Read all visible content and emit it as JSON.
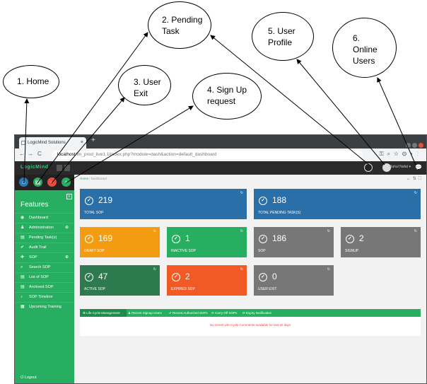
{
  "callouts": {
    "home": "1. Home",
    "pending_task": "2. Pending\nTask",
    "user_exit": "3. User\nExit",
    "signup_request": "4. Sign Up\nrequest",
    "user_profile": "5. User\nProfile",
    "online_users": "6.\nOnline\nUsers"
  },
  "browser": {
    "tab_title": "LogicMind Solutions",
    "tab_close": "×",
    "new_tab": "+",
    "url_host": "localhost",
    "url_path": "/lm_prod_live1.1/index.php?module=dash&action=default_dashboard",
    "nav_back": "←",
    "nav_forward": "→",
    "nav_reload": "C",
    "colors": {
      "close": "#e0553b",
      "chrome_dark": "#3c3f41"
    }
  },
  "app": {
    "logo": "LogicMind",
    "user_name": "Rahul Nafat",
    "user_caret": "▾",
    "quick_buttons": [
      {
        "icon": "home-icon",
        "glyph": "⌂",
        "color": "#2b7bb9"
      },
      {
        "icon": "pending-task-icon",
        "glyph": "▤",
        "color": "#27ae60"
      },
      {
        "icon": "user-exit-icon",
        "glyph": "−",
        "color": "#e74c3c"
      },
      {
        "icon": "signup-request-icon",
        "glyph": "+",
        "color": "#27ae60"
      }
    ]
  },
  "sidebar": {
    "title": "Features",
    "items": [
      {
        "label": "Dashboard",
        "icon": "dashboard-icon",
        "glyph": "◉"
      },
      {
        "label": "Administration",
        "icon": "admin-icon",
        "glyph": "♟",
        "plus": "⊕"
      },
      {
        "label": "Pending Task(s)",
        "icon": "pending-icon",
        "glyph": "▤"
      },
      {
        "label": "Audit Trail",
        "icon": "audit-icon",
        "glyph": "✔"
      },
      {
        "label": "SOP",
        "icon": "sop-icon",
        "glyph": "✚",
        "plus": "⊕"
      },
      {
        "label": "Search SOP",
        "icon": "search-icon",
        "glyph": "⌕"
      },
      {
        "label": "List of SOP",
        "icon": "list-icon",
        "glyph": "▤"
      },
      {
        "label": "Archived SOP",
        "icon": "archive-icon",
        "glyph": "▤"
      },
      {
        "label": "SOP Timeline",
        "icon": "timeline-icon",
        "glyph": "♪"
      },
      {
        "label": "Upcoming Training",
        "icon": "calendar-icon",
        "glyph": "▦"
      }
    ],
    "logout": "Logout"
  },
  "breadcrumb": {
    "home": "Home",
    "sep": "/",
    "current": "Dashboard"
  },
  "cards": [
    {
      "value": "219",
      "label": "Total SOP",
      "color": "#2b6fa8"
    },
    {
      "value": "188",
      "label": "Total Pending Task(s)",
      "color": "#2b6fa8"
    },
    {
      "value": "169",
      "label": "Draft SOP",
      "color": "#f39c12"
    },
    {
      "value": "1",
      "label": "Inactive SOP",
      "color": "#27ae60"
    },
    {
      "value": "186",
      "label": "SOP",
      "color": "#777777"
    },
    {
      "value": "2",
      "label": "Signup",
      "color": "#777777"
    },
    {
      "value": "47",
      "label": "Active SOP",
      "color": "#2d7a4f"
    },
    {
      "value": "2",
      "label": "Expired SOP",
      "color": "#f15a24"
    },
    {
      "value": "0",
      "label": "User Exit",
      "color": "#777777"
    }
  ],
  "panel": {
    "tabs": [
      "Life Cycle Management",
      "Recent Signup Users",
      "Recent Authorized SOPs",
      "Carry Off SOPs",
      "Expiry Notification"
    ],
    "empty_message": "No recent Life Cycle Comments available for last 30 days"
  }
}
